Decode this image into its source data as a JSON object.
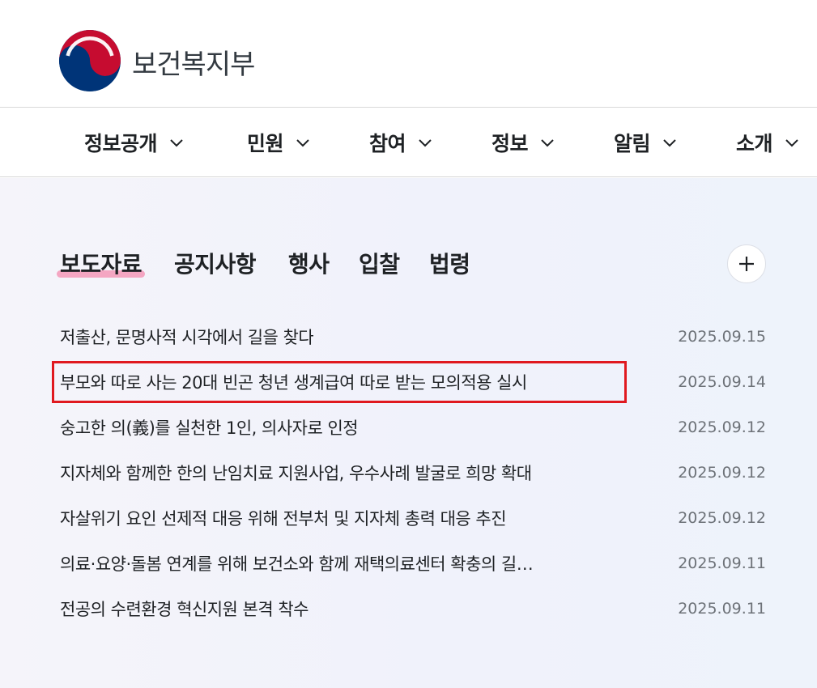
{
  "brand": {
    "name": "보건복지부",
    "colors": {
      "red": "#c60c30",
      "blue": "#003478"
    }
  },
  "gnb": {
    "items": [
      {
        "label": "정보공개"
      },
      {
        "label": "민원"
      },
      {
        "label": "참여"
      },
      {
        "label": "정보"
      },
      {
        "label": "알림"
      },
      {
        "label": "소개"
      }
    ]
  },
  "board": {
    "tabs": [
      {
        "label": "보도자료",
        "active": true
      },
      {
        "label": "공지사항"
      },
      {
        "label": "행사"
      },
      {
        "label": "입찰"
      },
      {
        "label": "법령"
      }
    ],
    "more_icon": "plus-icon",
    "items": [
      {
        "title": "저출산, 문명사적 시각에서 길을 찾다",
        "date": "2025.09.15"
      },
      {
        "title": "부모와 따로 사는 20대 빈곤 청년 생계급여 따로 받는 모의적용 실시",
        "date": "2025.09.14",
        "highlighted": true
      },
      {
        "title": "숭고한 의(義)를 실천한 1인, 의사자로 인정",
        "date": "2025.09.12"
      },
      {
        "title": "지자체와 함께한 한의 난임치료 지원사업, 우수사례 발굴로 희망 확대",
        "date": "2025.09.12"
      },
      {
        "title": "자살위기 요인 선제적 대응 위해 전부처 및 지자체 총력 대응 추진",
        "date": "2025.09.12"
      },
      {
        "title": "의료·요양·돌봄 연계를 위해 보건소와 함께 재택의료센터 확충의 길…",
        "date": "2025.09.11"
      },
      {
        "title": "전공의 수련환경 혁신지원 본격 착수",
        "date": "2025.09.11"
      }
    ]
  },
  "highlight_color": "#e0191f",
  "tab_underline_color": "#f4a6c2"
}
